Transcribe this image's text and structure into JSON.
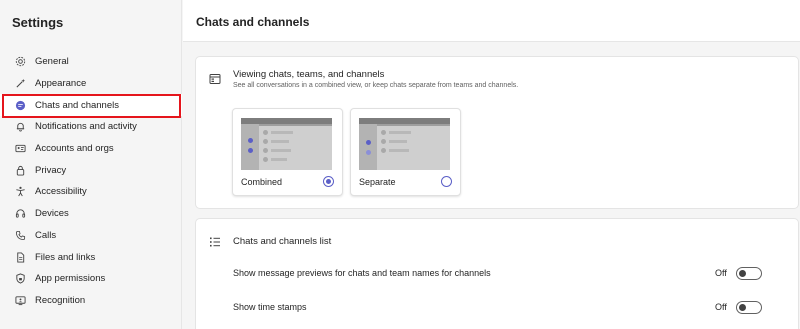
{
  "sidebar": {
    "title": "Settings",
    "items": [
      {
        "label": "General",
        "icon": "gear-icon"
      },
      {
        "label": "Appearance",
        "icon": "magic-wand-icon"
      },
      {
        "label": "Chats and channels",
        "icon": "chat-bubble-icon"
      },
      {
        "label": "Notifications and activity",
        "icon": "bell-icon"
      },
      {
        "label": "Accounts and orgs",
        "icon": "id-card-icon"
      },
      {
        "label": "Privacy",
        "icon": "lock-icon"
      },
      {
        "label": "Accessibility",
        "icon": "accessibility-icon"
      },
      {
        "label": "Devices",
        "icon": "headset-icon"
      },
      {
        "label": "Calls",
        "icon": "phone-icon"
      },
      {
        "label": "Files and links",
        "icon": "document-icon"
      },
      {
        "label": "App permissions",
        "icon": "shield-lock-icon"
      },
      {
        "label": "Recognition",
        "icon": "monitor-person-icon"
      }
    ],
    "active_index": 2
  },
  "main": {
    "title": "Chats and channels",
    "viewing": {
      "title": "Viewing chats, teams, and channels",
      "subtitle": "See all conversations in a combined view, or keep chats separate from teams and channels.",
      "options": [
        {
          "label": "Combined",
          "selected": true
        },
        {
          "label": "Separate",
          "selected": false
        }
      ]
    },
    "list_section": {
      "title": "Chats and channels list",
      "rows": [
        {
          "label": "Show message previews for chats and team names for channels",
          "state": "Off"
        },
        {
          "label": "Show time stamps",
          "state": "Off"
        }
      ]
    }
  },
  "colors": {
    "accent": "#5b5fc7",
    "highlight": "#e5151c"
  }
}
